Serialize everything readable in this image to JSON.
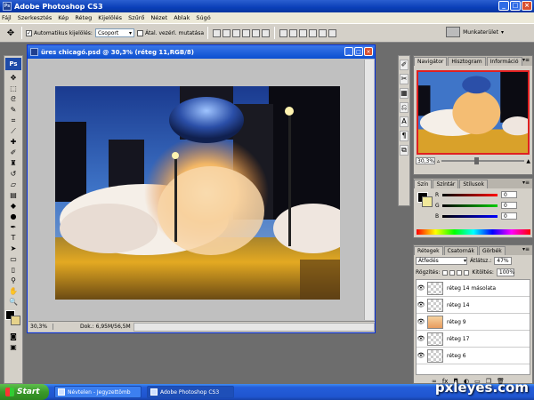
{
  "app": {
    "title": "Adobe Photoshop CS3"
  },
  "menu": [
    "Fájl",
    "Szerkesztés",
    "Kép",
    "Réteg",
    "Kijelölés",
    "Szűrő",
    "Nézet",
    "Ablak",
    "Súgó"
  ],
  "options": {
    "auto_select_label": "Automatikus kijelölés:",
    "auto_select_value": "Csoport",
    "transform_label": "Átal. vezérl. mutatása",
    "workspace_label": "Munkaterület"
  },
  "toolbox": {
    "logo": "Ps",
    "tools": [
      "move",
      "marquee",
      "lasso",
      "quick-select",
      "crop",
      "slice",
      "healing",
      "brush",
      "stamp",
      "history-brush",
      "eraser",
      "gradient",
      "blur",
      "dodge",
      "pen",
      "type",
      "path-select",
      "shape",
      "notes",
      "eyedropper",
      "hand",
      "zoom"
    ]
  },
  "document": {
    "title": "üres chicagó.psd @ 30,3% (réteg 11,RGB/8)",
    "zoom": "30,3%",
    "doc_info": "Dok.: 6,95M/56,5M"
  },
  "navigator": {
    "tabs": [
      "Navigátor",
      "Hisztogram",
      "Információ"
    ],
    "zoom": "30,3%"
  },
  "color_panel": {
    "tabs": [
      "Szín",
      "Színtár",
      "Stílusok"
    ],
    "r_label": "R",
    "g_label": "G",
    "b_label": "B",
    "r": "0",
    "g": "0",
    "b": "0",
    "fg_color": "#000000",
    "bg_color": "#f0e89a"
  },
  "layers_panel": {
    "tabs": [
      "Rétegek",
      "Csatornák",
      "Görbék"
    ],
    "blend_mode": "Átfedés",
    "opacity_label": "Átlátsz.:",
    "opacity": "47%",
    "lock_label": "Rögzítés:",
    "fill_label": "Kitöltés:",
    "fill": "100%",
    "layers": [
      {
        "name": "réteg 14 másolata",
        "thumb": "transparent"
      },
      {
        "name": "réteg 14",
        "thumb": "transparent"
      },
      {
        "name": "réteg 9",
        "thumb": "image"
      },
      {
        "name": "réteg 17",
        "thumb": "transparent"
      },
      {
        "name": "réteg 6",
        "thumb": "transparent"
      }
    ]
  },
  "taskbar": {
    "start": "Start",
    "tasks": [
      {
        "label": "Névtelen - Jegyzettömb"
      },
      {
        "label": "Adobe Photoshop CS3"
      }
    ]
  },
  "watermark": "pxleyes.com"
}
